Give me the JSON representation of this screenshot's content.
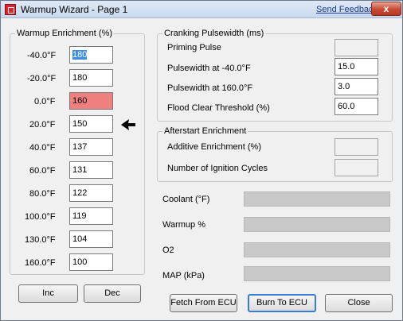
{
  "window": {
    "title": "Warmup Wizard - Page 1",
    "feedback_link": "Send Feedback",
    "close_glyph": "x",
    "icon": "app-icon"
  },
  "warmup": {
    "title": "Warmup Enrichment (%)",
    "rows": [
      {
        "label": "-40.0°F",
        "value": "180"
      },
      {
        "label": "-20.0°F",
        "value": "180"
      },
      {
        "label": "0.0°F",
        "value": "160"
      },
      {
        "label": "20.0°F",
        "value": "150"
      },
      {
        "label": "40.0°F",
        "value": "137"
      },
      {
        "label": "60.0°F",
        "value": "131"
      },
      {
        "label": "80.0°F",
        "value": "122"
      },
      {
        "label": "100.0°F",
        "value": "119"
      },
      {
        "label": "130.0°F",
        "value": "104"
      },
      {
        "label": "160.0°F",
        "value": "100"
      }
    ],
    "inc_label": "Inc",
    "dec_label": "Dec",
    "highlight_color": "#f08080",
    "pointer_icon": "arrow-left-icon"
  },
  "cranking": {
    "title": "Cranking Pulsewidth (ms)",
    "priming_label": "Priming Pulse",
    "priming_value": "",
    "pw_low_label": "Pulsewidth at -40.0°F",
    "pw_low_value": "15.0",
    "pw_high_label": "Pulsewidth at 160.0°F",
    "pw_high_value": "3.0",
    "flood_label": "Flood Clear Threshold (%)",
    "flood_value": "60.0"
  },
  "afterstart": {
    "title": "Afterstart Enrichment",
    "additive_label": "Additive Enrichment (%)",
    "additive_value": "",
    "cycles_label": "Number of Ignition Cycles",
    "cycles_value": ""
  },
  "gauges": [
    {
      "label": "Coolant (°F)"
    },
    {
      "label": "Warmup %"
    },
    {
      "label": "O2"
    },
    {
      "label": "MAP (kPa)"
    }
  ],
  "footer": {
    "fetch_label": "Fetch From ECU",
    "burn_label": "Burn To ECU",
    "close_label": "Close"
  },
  "colors": {
    "gauge": "#c8c8c8",
    "focus": "#3a7bd5",
    "selection": "#3a8ee6"
  }
}
